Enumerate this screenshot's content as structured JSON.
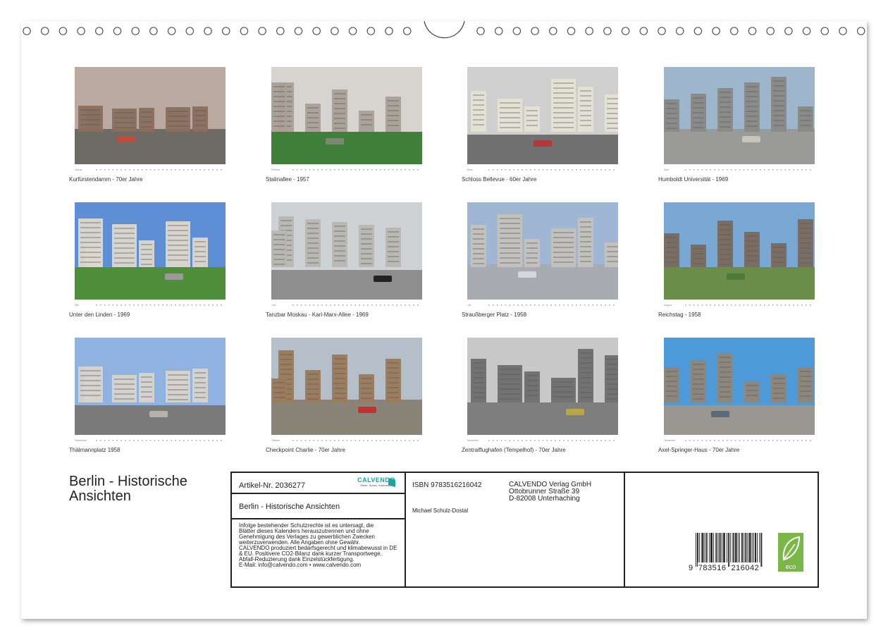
{
  "calendar": {
    "title": "Berlin - Historische Ansichten"
  },
  "photos": [
    {
      "caption": "Kurfürstendamm - 70er Jahre",
      "month": "Januar"
    },
    {
      "caption": "Stalinallee - 1957",
      "month": "Februar"
    },
    {
      "caption": "Schloss Bellevue - 60er Jahre",
      "month": "März"
    },
    {
      "caption": "Humboldt Universität - 1969",
      "month": "April"
    },
    {
      "caption": "Unter den Linden - 1969",
      "month": "Mai"
    },
    {
      "caption": "Tanzbar Moskau - Karl-Marx-Allee - 1969",
      "month": "Juni"
    },
    {
      "caption": "Straußberger Platz - 1958",
      "month": "Juli"
    },
    {
      "caption": "Reichstag - 1958",
      "month": "August"
    },
    {
      "caption": "Thälmannplatz 1958",
      "month": "September"
    },
    {
      "caption": "Checkpoint Charlie - 70er Jahre",
      "month": "Oktober"
    },
    {
      "caption": "Zentralflughafen (Tempelhof) - 70er Jahre",
      "month": "November"
    },
    {
      "caption": "Axel-Springer-Haus - 70er Jahre",
      "month": "Dezember"
    }
  ],
  "info": {
    "article": "Artikel-Nr. 2036277",
    "brand": "CALVENDO",
    "brand_tagline": "Bilder. Spass. Inspiration.",
    "product_title": "Berlin - Historische Ansichten",
    "legal_lines": [
      "Infolge bestehender Schutzrechte ist es untersagt, die",
      "Blätter dieses Kalenders herauszutrennen und ohne",
      "Genehmigung des Verlages zu gewerblichen Zwecken",
      "weiterzuverwenden. Alle Angaben ohne Gewähr.",
      "CALVENDO produziert bedarfsgerecht und klimabewusst in DE",
      "& EU. Positivere CO2-Bilanz dank kurzer Transportwege.",
      "Abfall-Reduzierung dank Einzelstückfertigung.",
      "E-Mail: info@calvendo.com • www.calvendo.com"
    ],
    "isbn": "ISBN 9783516216042",
    "author": "Michael Schulz-Dostal",
    "publisher_lines": [
      "CALVENDO Verlag GmbH",
      "Ottobrunner Straße 39",
      "D-82008 Unterhaching"
    ],
    "barcode_digits": "9  783516  216042",
    "eco_label": "eco"
  },
  "colors": {
    "border": "#222222",
    "eco_green": "#7ab648",
    "brand_teal": "#1aa3a3"
  }
}
